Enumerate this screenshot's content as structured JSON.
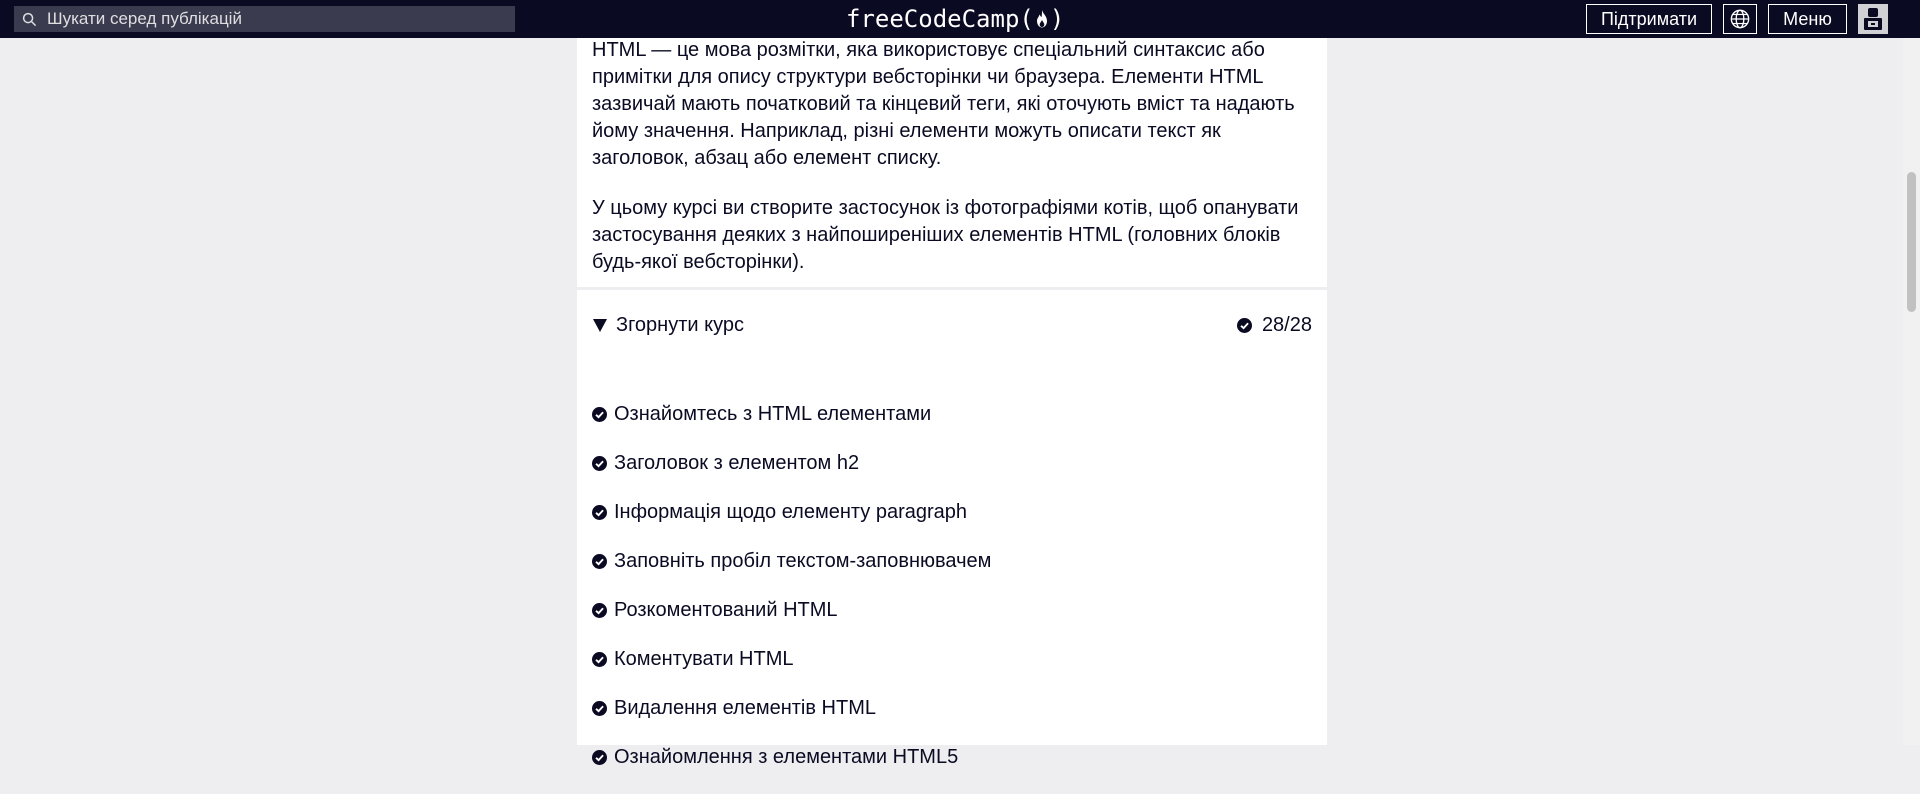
{
  "nav": {
    "search_placeholder": "Шукати серед публікацій",
    "logo_left": "freeCodeCamp(",
    "logo_right": ")",
    "donate_label": "Підтримати",
    "menu_label": "Меню",
    "icons": [
      "search-icon",
      "flame-icon",
      "globe-icon",
      "avatar-icon"
    ]
  },
  "intro": {
    "paragraph1": "HTML — це мова розмітки, яка використовує спеціальний синтаксис або примітки для опису структури вебсторінки чи браузера. Елементи HTML зазвичай мають початковий та кінцевий теги, які оточують вміст та надають йому значення. Наприклад, різні елементи можуть описати текст як заголовок, абзац або елемент списку.",
    "paragraph2": "У цьому курсі ви створите застосунок із фотографіями котів, щоб опанувати застосування деяких з найпоширеніших елементів HTML (головних блоків будь-якої вебсторінки)."
  },
  "course": {
    "toggle_label": "Згорнути курс",
    "progress": "28/28",
    "steps": [
      "Ознайомтесь з HTML елементами",
      "Заголовок з елементом h2",
      "Інформація щодо елементу paragraph",
      "Заповніть пробіл текстом-заповнювачем",
      "Розкоментований HTML",
      "Коментувати HTML",
      "Видалення елементів HTML",
      "Ознайомлення з елементами HTML5"
    ]
  },
  "colors": {
    "nav_bg": "#0a0a23",
    "page_bg": "#eeeef0",
    "panel_bg": "#ffffff",
    "search_bg": "#3b3b4f",
    "text": "#0a0a23"
  }
}
